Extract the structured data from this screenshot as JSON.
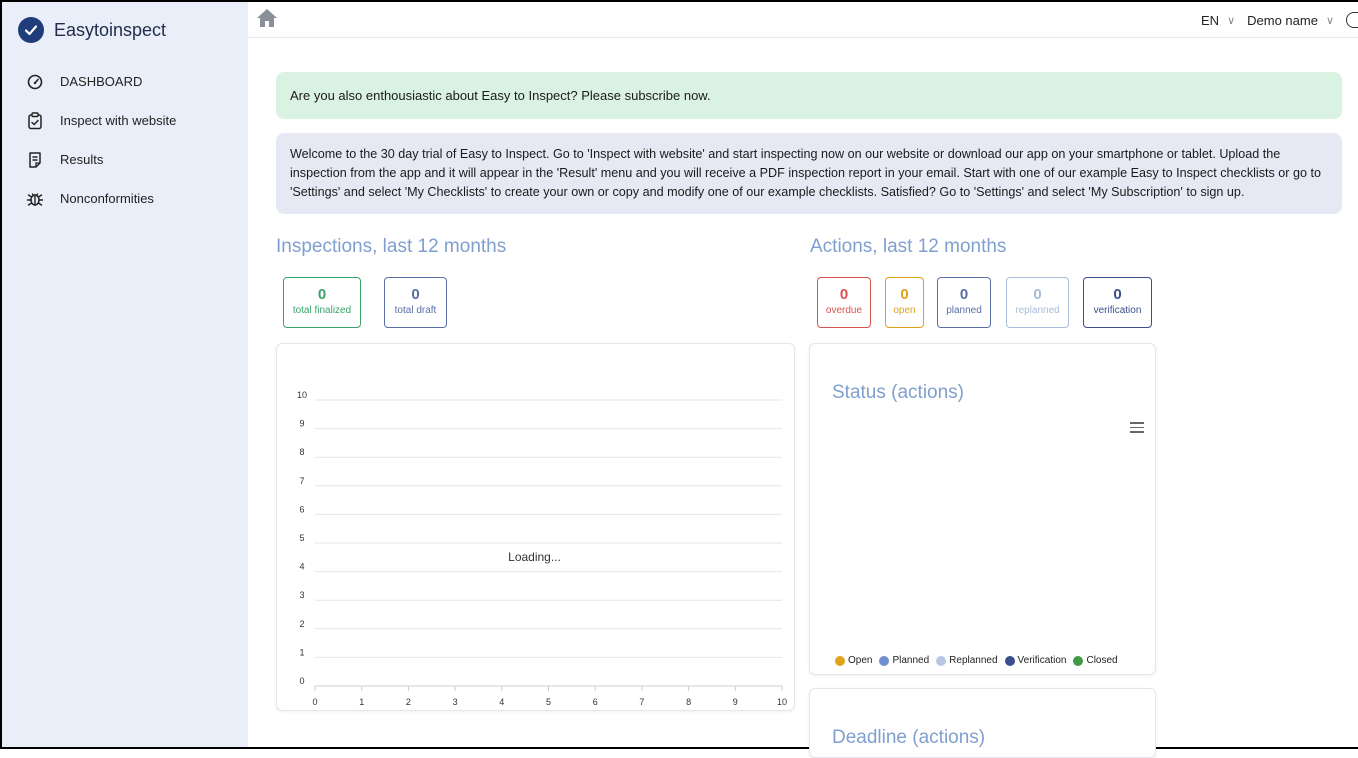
{
  "app": {
    "name": "Easytoinspect"
  },
  "sidebar": {
    "items": [
      {
        "label": "DASHBOARD",
        "icon": "gauge-icon"
      },
      {
        "label": "Inspect with website",
        "icon": "clipboard-check-icon"
      },
      {
        "label": "Results",
        "icon": "document-list-icon"
      },
      {
        "label": "Nonconformities",
        "icon": "bug-icon"
      }
    ]
  },
  "topbar": {
    "language": "EN",
    "user": "Demo name"
  },
  "alerts": {
    "subscribe": "Are you also enthousiastic about Easy to Inspect? Please subscribe now.",
    "welcome": "Welcome to the 30 day trial of Easy to Inspect. Go to 'Inspect with website' and start inspecting now on our website or download our app on your smartphone or tablet. Upload the inspection from the app and it will appear in the 'Result' menu and you will receive a PDF inspection report in your email. Start with one of our example Easy to Inspect checklists or go to 'Settings' and select 'My Checklists' to create your own or copy and modify one of our example checklists. Satisfied? Go to 'Settings' and select 'My Subscription' to sign up."
  },
  "inspections": {
    "title": "Inspections, last 12 months",
    "stats": [
      {
        "value": "0",
        "label": "total finalized",
        "color": "#3aa56a"
      },
      {
        "value": "0",
        "label": "total draft",
        "color": "#5a6fa6"
      }
    ]
  },
  "actions": {
    "title": "Actions, last 12 months",
    "stats": [
      {
        "value": "0",
        "label": "overdue",
        "color": "#d9534f"
      },
      {
        "value": "0",
        "label": "open",
        "color": "#e0a21b"
      },
      {
        "value": "0",
        "label": "planned",
        "color": "#5a6fa6"
      },
      {
        "value": "0",
        "label": "replanned",
        "color": "#a9bcd9"
      },
      {
        "value": "0",
        "label": "verification",
        "color": "#3b4f8f"
      }
    ]
  },
  "chart_data": [
    {
      "type": "line",
      "title": "",
      "xlabel": "",
      "ylabel": "",
      "xlim": [
        0,
        10
      ],
      "ylim": [
        0,
        10
      ],
      "x_ticks": [
        "0",
        "1",
        "2",
        "3",
        "4",
        "5",
        "6",
        "7",
        "8",
        "9",
        "10"
      ],
      "y_ticks": [
        "0",
        "1",
        "2",
        "3",
        "4",
        "5",
        "6",
        "7",
        "8",
        "9",
        "10"
      ],
      "grid": true,
      "series": [],
      "overlay_text": "Loading..."
    },
    {
      "type": "pie",
      "title": "Status (actions)",
      "legend_position": "bottom",
      "series": [
        {
          "name": "Open",
          "color": "#e0a21b"
        },
        {
          "name": "Planned",
          "color": "#6f8fd0"
        },
        {
          "name": "Replanned",
          "color": "#b7c7e2"
        },
        {
          "name": "Verification",
          "color": "#3b4f8f"
        },
        {
          "name": "Closed",
          "color": "#3f9a45"
        }
      ]
    }
  ],
  "deadline": {
    "title": "Deadline (actions)"
  }
}
